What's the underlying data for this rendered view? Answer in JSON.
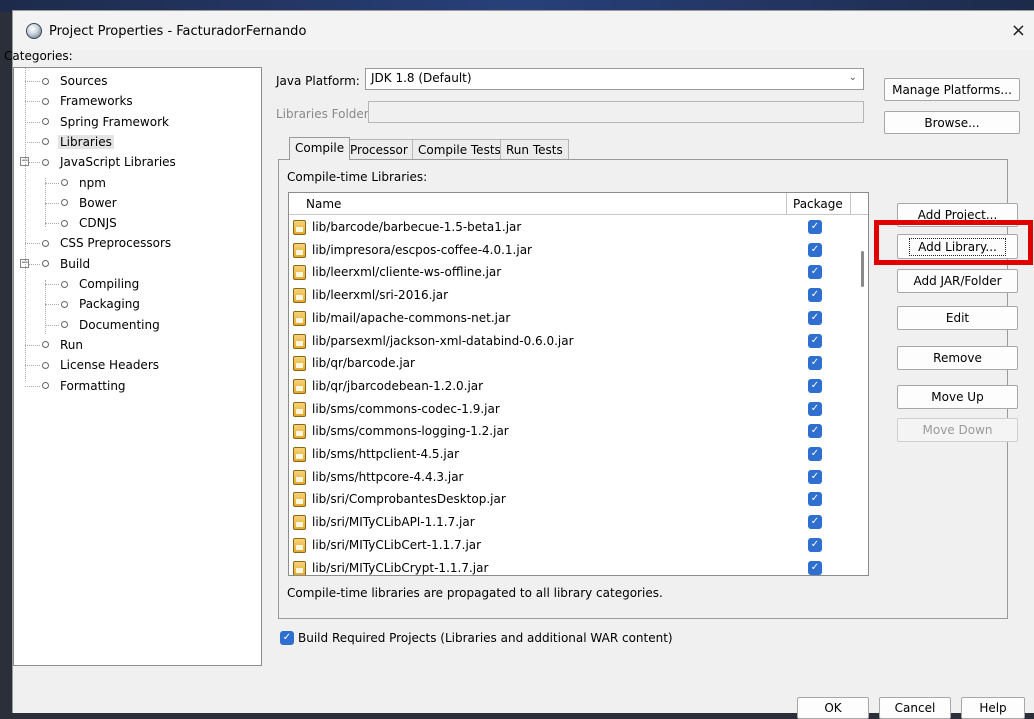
{
  "window": {
    "title": "Project Properties - FacturadorFernando",
    "close_glyph": "×"
  },
  "categories": {
    "label": "Categories:",
    "items": [
      {
        "label": "Sources"
      },
      {
        "label": "Frameworks"
      },
      {
        "label": "Spring Framework"
      },
      {
        "label": "Libraries",
        "selected": true
      },
      {
        "label": "JavaScript Libraries",
        "expandable": true
      },
      {
        "label": "npm"
      },
      {
        "label": "Bower"
      },
      {
        "label": "CDNJS"
      },
      {
        "label": "CSS Preprocessors"
      },
      {
        "label": "Build",
        "expandable": true
      },
      {
        "label": "Compiling"
      },
      {
        "label": "Packaging"
      },
      {
        "label": "Documenting"
      },
      {
        "label": "Run"
      },
      {
        "label": "License Headers"
      },
      {
        "label": "Formatting"
      }
    ]
  },
  "java_platform": {
    "label": "Java Platform:",
    "value": "JDK 1.8 (Default)",
    "manage_button": "Manage Platforms..."
  },
  "libraries_folder": {
    "label": "Libraries Folder:",
    "value": "",
    "browse_button": "Browse..."
  },
  "tabs": [
    {
      "label": "Compile",
      "active": true
    },
    {
      "label": "Processor"
    },
    {
      "label": "Compile Tests"
    },
    {
      "label": "Run Tests"
    }
  ],
  "compile": {
    "label": "Compile-time Libraries:",
    "columns": {
      "name": "Name",
      "package": "Package"
    },
    "rows": [
      {
        "name": "lib/barcode/barbecue-1.5-beta1.jar",
        "package": true
      },
      {
        "name": "lib/impresora/escpos-coffee-4.0.1.jar",
        "package": true
      },
      {
        "name": "lib/leerxml/cliente-ws-offline.jar",
        "package": true
      },
      {
        "name": "lib/leerxml/sri-2016.jar",
        "package": true
      },
      {
        "name": "lib/mail/apache-commons-net.jar",
        "package": true
      },
      {
        "name": "lib/parsexml/jackson-xml-databind-0.6.0.jar",
        "package": true
      },
      {
        "name": "lib/qr/barcode.jar",
        "package": true
      },
      {
        "name": "lib/qr/jbarcodebean-1.2.0.jar",
        "package": true
      },
      {
        "name": "lib/sms/commons-codec-1.9.jar",
        "package": true
      },
      {
        "name": "lib/sms/commons-logging-1.2.jar",
        "package": true
      },
      {
        "name": "lib/sms/httpclient-4.5.jar",
        "package": true
      },
      {
        "name": "lib/sms/httpcore-4.4.3.jar",
        "package": true
      },
      {
        "name": "lib/sri/ComprobantesDesktop.jar",
        "package": true
      },
      {
        "name": "lib/sri/MITyCLibAPI-1.1.7.jar",
        "package": true
      },
      {
        "name": "lib/sri/MITyCLibCert-1.1.7.jar",
        "package": true
      },
      {
        "name": "lib/sri/MITyCLibCrypt-1.1.7.jar",
        "package": true
      }
    ],
    "note": "Compile-time libraries are propagated to all library categories.",
    "buttons": {
      "add_project": "Add Project...",
      "add_library": "Add Library...",
      "add_jar": "Add JAR/Folder",
      "edit": "Edit",
      "remove": "Remove",
      "move_up": "Move Up",
      "move_down": "Move Down"
    },
    "build_required": {
      "label": "Build Required Projects (Libraries and additional WAR content)",
      "checked": true
    }
  },
  "footer": {
    "ok": "OK",
    "cancel": "Cancel",
    "help": "Help"
  },
  "colors": {
    "highlight": "#e00000",
    "checkbox": "#2f6fd0"
  }
}
